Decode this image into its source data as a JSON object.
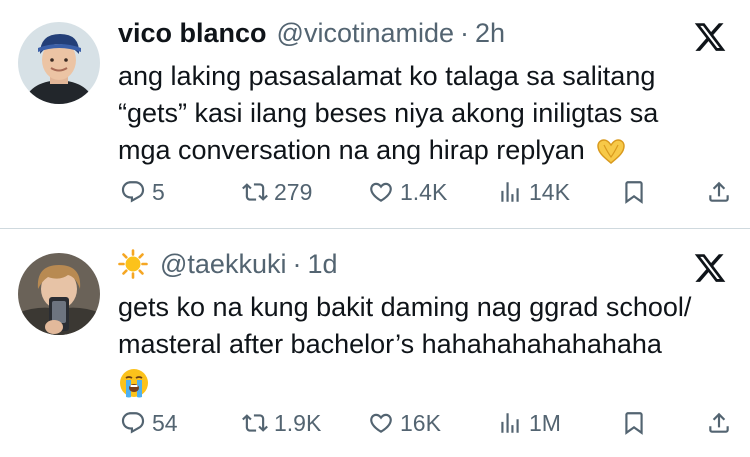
{
  "tweets": [
    {
      "name": "vico blanco",
      "handle": "@vicotinamide",
      "separator": "·",
      "time": "2h",
      "text_lines": [
        "ang laking pasasalamat ko talaga sa salitang",
        "“gets” kasi ilang beses niya akong iniligtas sa",
        "mga conversation na ang hirap replyan"
      ],
      "emoji": "heart-hands",
      "stats": {
        "replies": "5",
        "reposts": "279",
        "likes": "1.4K",
        "views": "14K"
      }
    },
    {
      "name_emoji": "sun",
      "handle": "@taekkuki",
      "separator": "·",
      "time": "1d",
      "text_lines": [
        "gets ko na kung bakit daming nag ggrad school/",
        "masteral after bachelor’s hahahahahahahaha"
      ],
      "emoji": "loudly-crying-face",
      "stats": {
        "replies": "54",
        "reposts": "1.9K",
        "likes": "16K",
        "views": "1M"
      }
    }
  ],
  "colors": {
    "text": "#0f1419",
    "secondary": "#536471",
    "divider": "#cfd9de"
  },
  "icons": [
    "x-logo-icon",
    "reply-icon",
    "repost-icon",
    "like-icon",
    "views-icon",
    "bookmark-icon",
    "share-icon"
  ]
}
